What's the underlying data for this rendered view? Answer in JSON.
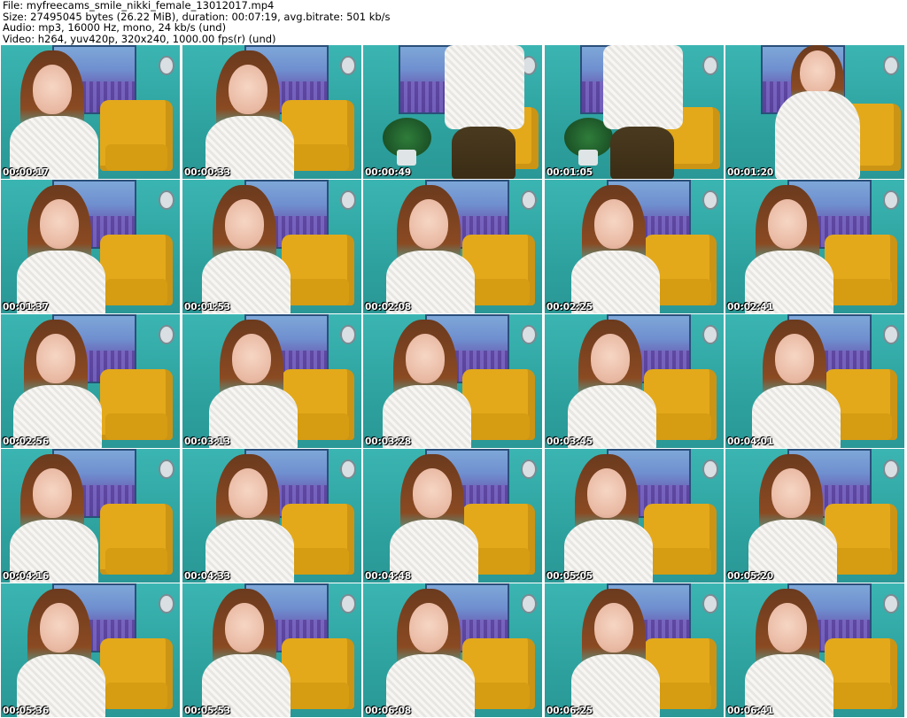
{
  "header": {
    "file_line": "File: myfreecams_smile_nikki_female_13012017.mp4",
    "size_line": "Size: 27495045 bytes (26.22 MiB), duration: 00:07:19, avg.bitrate: 501 kb/s",
    "audio_line": "Audio: mp3, 16000 Hz, mono, 24 kb/s (und)",
    "video_line": "Video: h264, yuv420p, 320x240, 1000.00 fps(r) (und)"
  },
  "frames": [
    {
      "timestamp": "00:00:17",
      "pose": "seated-left"
    },
    {
      "timestamp": "00:00:33",
      "pose": "seated-center"
    },
    {
      "timestamp": "00:00:49",
      "pose": "standing-torso"
    },
    {
      "timestamp": "00:01:05",
      "pose": "standing-side"
    },
    {
      "timestamp": "00:01:20",
      "pose": "standing-far"
    },
    {
      "timestamp": "00:01:37",
      "pose": "seated-left"
    },
    {
      "timestamp": "00:01:53",
      "pose": "seated-center"
    },
    {
      "timestamp": "00:02:08",
      "pose": "seated-center"
    },
    {
      "timestamp": "00:02:25",
      "pose": "seated-center"
    },
    {
      "timestamp": "00:02:41",
      "pose": "seated-center"
    },
    {
      "timestamp": "00:02:56",
      "pose": "seated-left"
    },
    {
      "timestamp": "00:03:13",
      "pose": "seated-center"
    },
    {
      "timestamp": "00:03:28",
      "pose": "seated-center"
    },
    {
      "timestamp": "00:03:45",
      "pose": "seated-center"
    },
    {
      "timestamp": "00:04:01",
      "pose": "seated-center"
    },
    {
      "timestamp": "00:04:16",
      "pose": "seated-left"
    },
    {
      "timestamp": "00:04:33",
      "pose": "seated-center"
    },
    {
      "timestamp": "00:04:48",
      "pose": "seated-center"
    },
    {
      "timestamp": "00:05:05",
      "pose": "seated-center"
    },
    {
      "timestamp": "00:05:20",
      "pose": "seated-center"
    },
    {
      "timestamp": "00:05:36",
      "pose": "seated-left"
    },
    {
      "timestamp": "00:05:53",
      "pose": "seated-center"
    },
    {
      "timestamp": "00:06:08",
      "pose": "seated-center"
    },
    {
      "timestamp": "00:06:25",
      "pose": "seated-center"
    },
    {
      "timestamp": "00:06:41",
      "pose": "seated-center"
    }
  ],
  "colors": {
    "wall": "#2fa7a4",
    "chair": "#e3a91b",
    "hair": "#7a4020",
    "hair_tip": "#2dc3c0",
    "blouse": "#f3f2ee",
    "timestamp": "#ffffff"
  }
}
